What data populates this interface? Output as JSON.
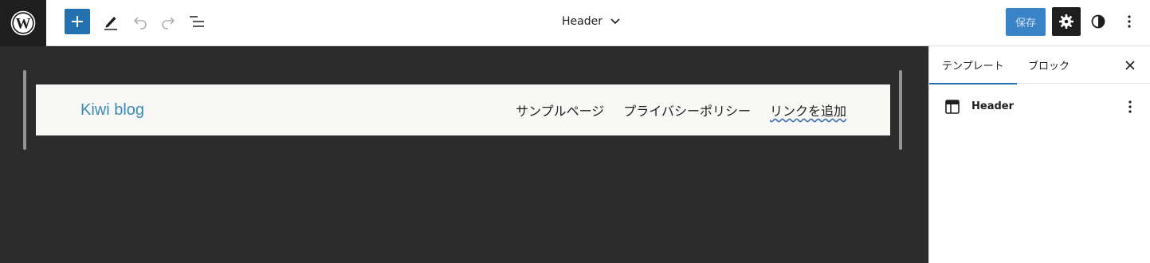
{
  "toolbar": {
    "wp_logo_icon": "wordpress-logo-icon",
    "add_block_icon": "plus-icon",
    "tools_icon": "pencil-icon",
    "undo_icon": "undo-icon",
    "redo_icon": "redo-icon",
    "list_view_icon": "list-view-icon",
    "document_title": "Header",
    "save_label": "保存",
    "settings_icon": "gear-icon",
    "styles_icon": "half-circle-icon",
    "options_icon": "vertical-dots-icon",
    "accent_color": "#2271b1"
  },
  "canvas": {
    "site_title": "Kiwi blog",
    "nav_items": [
      "サンプルページ",
      "プライバシーポリシー"
    ],
    "nav_add_link": "リンクを追加",
    "link_color": "#3b8bb9",
    "background_color": "#2c2c2c"
  },
  "sidebar": {
    "tabs": [
      {
        "label": "テンプレート",
        "active": true
      },
      {
        "label": "ブロック",
        "active": false
      }
    ],
    "close_icon": "close-icon",
    "template": {
      "icon": "template-part-icon",
      "name": "Header",
      "options_icon": "vertical-dots-icon"
    }
  }
}
